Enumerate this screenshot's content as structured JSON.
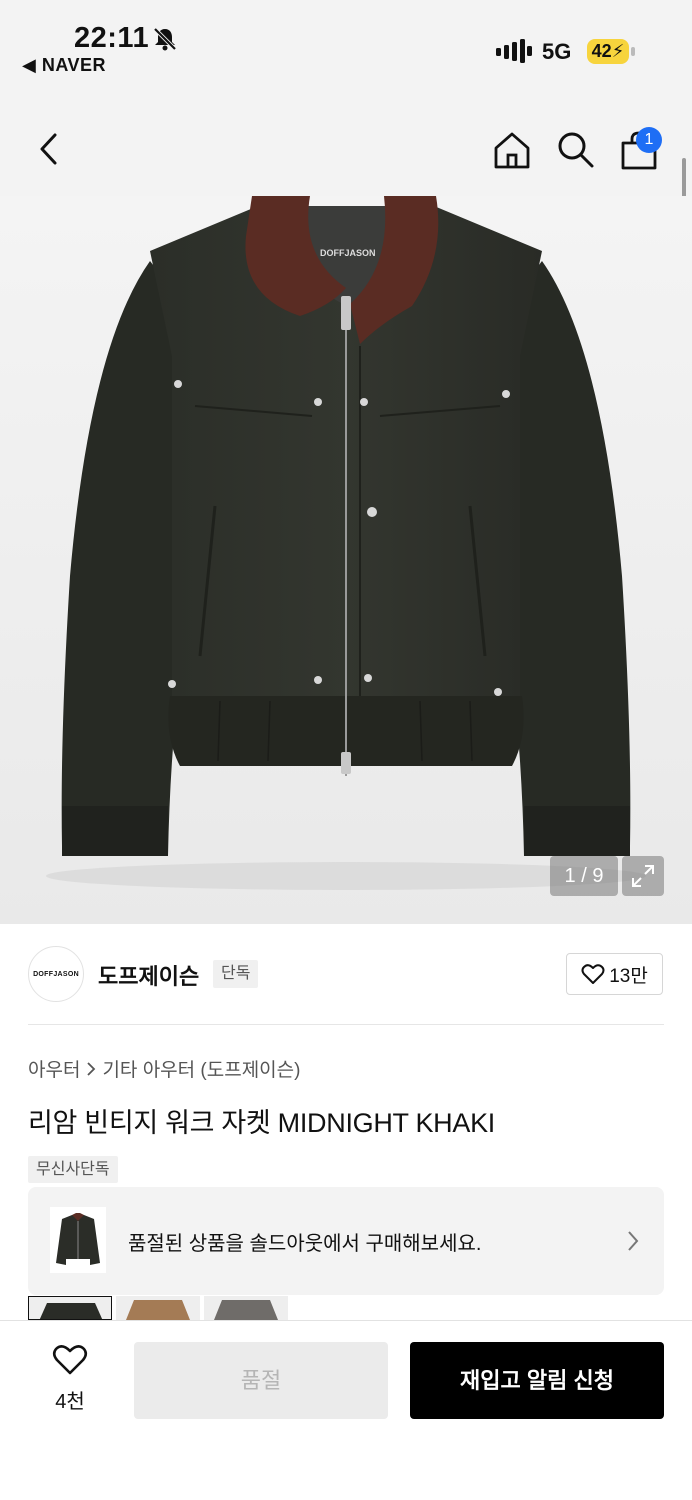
{
  "status_bar": {
    "time": "22:11",
    "back_app": "◀ NAVER",
    "network": "5G",
    "battery": "42"
  },
  "header": {
    "cart_count": "1"
  },
  "gallery": {
    "counter": "1 / 9",
    "brand_on_label": "DOFFJASON"
  },
  "brand": {
    "logo_text": "DOFFJASON",
    "name": "도프제이슨",
    "badge": "단독",
    "like_count": "13만"
  },
  "product": {
    "category_parent": "아우터",
    "category_child": "기타 아우터 (도프제이슨)",
    "title": "리암 빈티지 워크 자켓 MIDNIGHT KHAKI",
    "tag": "무신사단독"
  },
  "soldout_banner": {
    "text": "품절된 상품을 솔드아웃에서 구매해보세요."
  },
  "bottom_bar": {
    "wish_count": "4천",
    "soldout_label": "품절",
    "restock_label": "재입고 알림 신청"
  },
  "colors": {
    "accent_blue": "#1e6ef5",
    "battery_yellow": "#f7d43d",
    "primary_black": "#000000"
  }
}
